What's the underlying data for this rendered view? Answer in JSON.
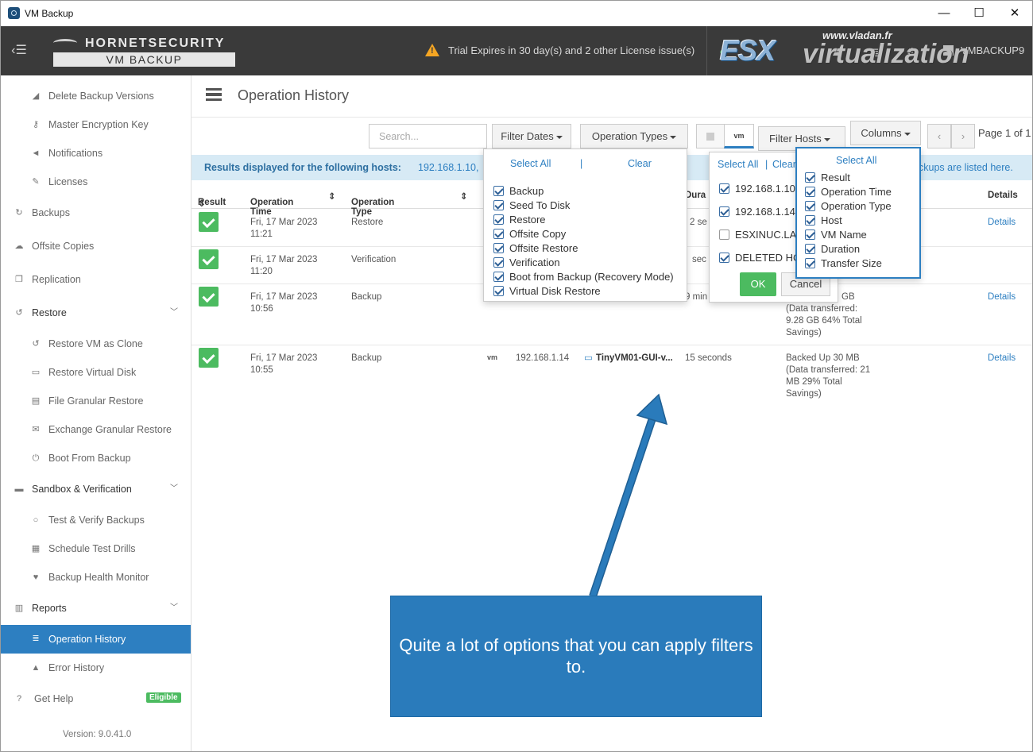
{
  "window": {
    "title": "VM Backup",
    "minimize": "—",
    "maximize": "☐",
    "close": "✕"
  },
  "header": {
    "brand_top": "HORNETSECURITY",
    "brand_bottom": "VM BACKUP",
    "warning_text": "Trial Expires in 30 day(s) and 2 other License issue(s)",
    "host_name": "VMBACKUP9",
    "watermark_esx": "ESX",
    "watermark_virt": "virtualization",
    "watermark_url": "www.vladan.fr"
  },
  "sidebar": {
    "items": [
      {
        "label": "Delete Backup Versions",
        "icon": "eraser-icon"
      },
      {
        "label": "Master Encryption Key",
        "icon": "key-icon"
      },
      {
        "label": "Notifications",
        "icon": "megaphone-icon"
      },
      {
        "label": "Licenses",
        "icon": "pencil-icon"
      },
      {
        "label": "Backups",
        "icon": "refresh-icon"
      },
      {
        "label": "Offsite Copies",
        "icon": "cloud-upload-icon"
      },
      {
        "label": "Replication",
        "icon": "copy-icon"
      },
      {
        "label": "Restore",
        "icon": "undo-icon"
      },
      {
        "label": "Restore VM as Clone",
        "icon": "undo-icon"
      },
      {
        "label": "Restore Virtual Disk",
        "icon": "disk-icon"
      },
      {
        "label": "File Granular Restore",
        "icon": "file-icon"
      },
      {
        "label": "Exchange Granular Restore",
        "icon": "envelope-icon"
      },
      {
        "label": "Boot From Backup",
        "icon": "power-icon"
      },
      {
        "label": "Sandbox & Verification",
        "icon": "server-icon"
      },
      {
        "label": "Test & Verify Backups",
        "icon": "circle-icon"
      },
      {
        "label": "Schedule Test Drills",
        "icon": "calendar-icon"
      },
      {
        "label": "Backup Health Monitor",
        "icon": "heartbeat-icon"
      },
      {
        "label": "Reports",
        "icon": "bar-chart-icon"
      },
      {
        "label": "Operation History",
        "icon": "list-icon"
      },
      {
        "label": "Error History",
        "icon": "warning-icon"
      },
      {
        "label": "Get Help",
        "icon": "help-icon"
      }
    ],
    "help_badge": "Eligible",
    "version": "Version: 9.0.41.0"
  },
  "page": {
    "title": "Operation History"
  },
  "toolbar": {
    "search_placeholder": "Search...",
    "filter_dates": "Filter Dates",
    "operation_types": "Operation Types",
    "vm_label": "vm",
    "filter_hosts": "Filter Hosts",
    "columns": "Columns",
    "prev": "‹",
    "next": "›",
    "page": "Page 1 of 1"
  },
  "banner": {
    "prefix": "Results displayed for the following hosts:",
    "hosts": "192.168.1.10,",
    "suffix": "ckups are listed here."
  },
  "table": {
    "headers": [
      "Result",
      "Operation Time",
      "Operation Type",
      "Dura",
      "Details"
    ],
    "rows": [
      {
        "date": "Fri, 17 Mar 2023",
        "time": "11:21",
        "type": "Restore",
        "duration": "2 se",
        "detail": "Details"
      },
      {
        "date": "Fri, 17 Mar 2023",
        "time": "11:20",
        "type": "Verification",
        "duration": "sec",
        "detail": ""
      },
      {
        "date": "Fri, 17 Mar 2023",
        "time": "10:56",
        "type": "Backup",
        "duration": "9 min",
        "size": "GB",
        "size2": "(Data transferred:",
        "size3": "9.28 GB 64% Total",
        "size4": "Savings)",
        "detail": "Details"
      },
      {
        "date": "Fri, 17 Mar 2023",
        "time": "10:55",
        "type": "Backup",
        "hv": "vm",
        "host": "192.168.1.14",
        "vm": "TinyVM01-GUI-v...",
        "duration": "15 seconds",
        "size": "Backed Up 30 MB",
        "size2": "(Data transferred: 21",
        "size3": "MB 29% Total",
        "size4": "Savings)",
        "detail": "Details"
      }
    ]
  },
  "optypes_dropdown": {
    "select_all": "Select All",
    "divider": "|",
    "clear": "Clear",
    "options": [
      "Backup",
      "Seed To Disk",
      "Restore",
      "Offsite Copy",
      "Offsite Restore",
      "Verification",
      "Boot from Backup (Recovery Mode)",
      "Virtual Disk Restore"
    ]
  },
  "hosts_dropdown": {
    "select_all": "Select All",
    "divider": "|",
    "clear": "Clear",
    "options": [
      {
        "label": "192.168.1.10",
        "checked": true
      },
      {
        "label": "192.168.1.14",
        "checked": true
      },
      {
        "label": "ESXINUC.LAB",
        "checked": false
      },
      {
        "label": "DELETED HC",
        "checked": true
      }
    ],
    "ok": "OK",
    "cancel": "Cancel"
  },
  "columns_dropdown": {
    "select_all": "Select All",
    "options": [
      "Result",
      "Operation Time",
      "Operation Type",
      "Host",
      "VM Name",
      "Duration",
      "Transfer Size"
    ],
    "highlight_color": "#2d7fc1"
  },
  "callout": {
    "text": "Quite a lot of options that you can apply filters to."
  },
  "colors": {
    "accent": "#2d7fc1",
    "success": "#4cbb60",
    "header": "#3a3a3a",
    "warning": "#f5a623"
  }
}
